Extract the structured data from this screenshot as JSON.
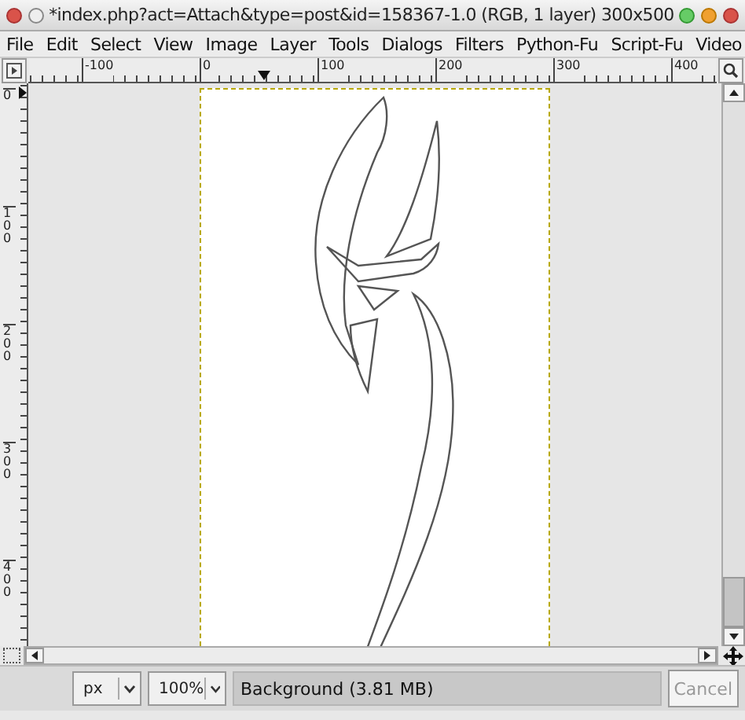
{
  "window": {
    "title": "*index.php?act=Attach&type=post&id=158367-1.0 (RGB, 1 layer) 300x500"
  },
  "menu": [
    {
      "label": "File"
    },
    {
      "label": "Edit"
    },
    {
      "label": "Select"
    },
    {
      "label": "View"
    },
    {
      "label": "Image"
    },
    {
      "label": "Layer"
    },
    {
      "label": "Tools"
    },
    {
      "label": "Dialogs"
    },
    {
      "label": "Filters"
    },
    {
      "label": "Python-Fu"
    },
    {
      "label": "Script-Fu"
    },
    {
      "label": "Video"
    }
  ],
  "horizontal_ruler": {
    "labels": [
      "-100",
      "0",
      "100",
      "200",
      "300",
      "400"
    ]
  },
  "vertical_ruler": {
    "labels": [
      "0",
      "100",
      "200",
      "300",
      "400"
    ]
  },
  "status_bar": {
    "unit": "px",
    "zoom": "100%",
    "message": "Background (3.81 MB)",
    "cancel": {
      "label": "Cancel",
      "disabled": true
    }
  }
}
